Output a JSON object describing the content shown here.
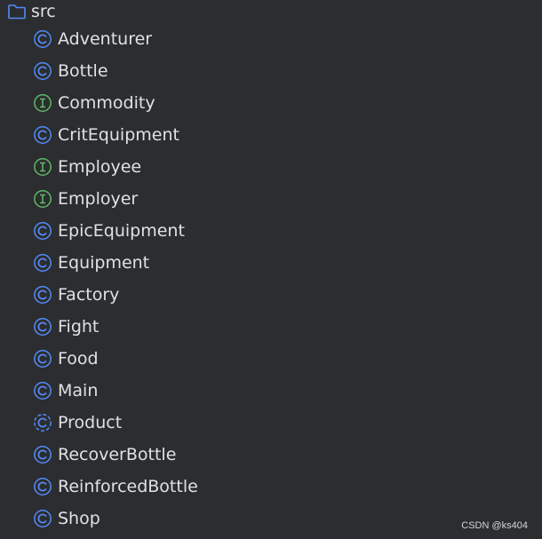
{
  "tree": {
    "root": {
      "label": "src",
      "icon": "folder-icon"
    },
    "items": [
      {
        "label": "Adventurer",
        "kind": "class",
        "icon": "class-icon"
      },
      {
        "label": "Bottle",
        "kind": "class",
        "icon": "class-icon"
      },
      {
        "label": "Commodity",
        "kind": "interface",
        "icon": "interface-icon"
      },
      {
        "label": "CritEquipment",
        "kind": "class",
        "icon": "class-icon"
      },
      {
        "label": "Employee",
        "kind": "interface",
        "icon": "interface-icon"
      },
      {
        "label": "Employer",
        "kind": "interface",
        "icon": "interface-icon"
      },
      {
        "label": "EpicEquipment",
        "kind": "class",
        "icon": "class-icon"
      },
      {
        "label": "Equipment",
        "kind": "class",
        "icon": "class-icon"
      },
      {
        "label": "Factory",
        "kind": "class",
        "icon": "class-icon"
      },
      {
        "label": "Fight",
        "kind": "class",
        "icon": "class-icon"
      },
      {
        "label": "Food",
        "kind": "class",
        "icon": "class-icon"
      },
      {
        "label": "Main",
        "kind": "class",
        "icon": "class-icon"
      },
      {
        "label": "Product",
        "kind": "abstract-class",
        "icon": "abstract-class-icon"
      },
      {
        "label": "RecoverBottle",
        "kind": "class",
        "icon": "class-icon"
      },
      {
        "label": "ReinforcedBottle",
        "kind": "class",
        "icon": "class-icon"
      },
      {
        "label": "Shop",
        "kind": "class",
        "icon": "class-icon"
      }
    ]
  },
  "watermark": "CSDN @ks404",
  "colors": {
    "background": "#2b2d30",
    "text": "#dfe1e5",
    "class_icon": "#548af7",
    "interface_icon": "#5fb865",
    "folder_icon": "#548af7"
  }
}
